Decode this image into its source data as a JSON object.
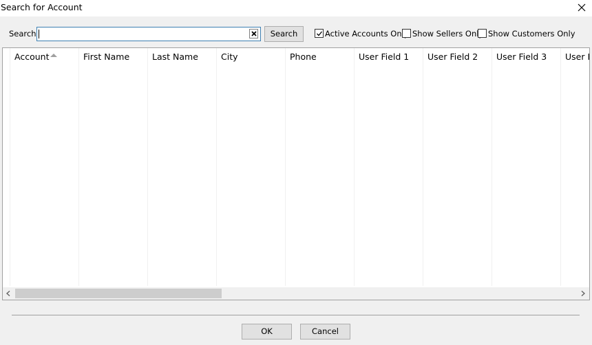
{
  "window": {
    "title": "Search for Account",
    "close_icon": "close-icon"
  },
  "search": {
    "label": "Search",
    "value": "",
    "button_label": "Search",
    "clear_icon": "clear-x-icon"
  },
  "filters": [
    {
      "label": "Active Accounts Only",
      "checked": true
    },
    {
      "label": "Show Sellers Only",
      "checked": false
    },
    {
      "label": "Show Customers Only",
      "checked": false
    }
  ],
  "grid": {
    "columns": [
      {
        "label": "Account",
        "sorted": "ascending"
      },
      {
        "label": "First Name"
      },
      {
        "label": "Last Name"
      },
      {
        "label": "City"
      },
      {
        "label": "Phone"
      },
      {
        "label": "User Field 1"
      },
      {
        "label": "User Field 2"
      },
      {
        "label": "User Field 3"
      },
      {
        "label": "User F"
      }
    ],
    "rows": []
  },
  "footer": {
    "ok_label": "OK",
    "cancel_label": "Cancel"
  }
}
